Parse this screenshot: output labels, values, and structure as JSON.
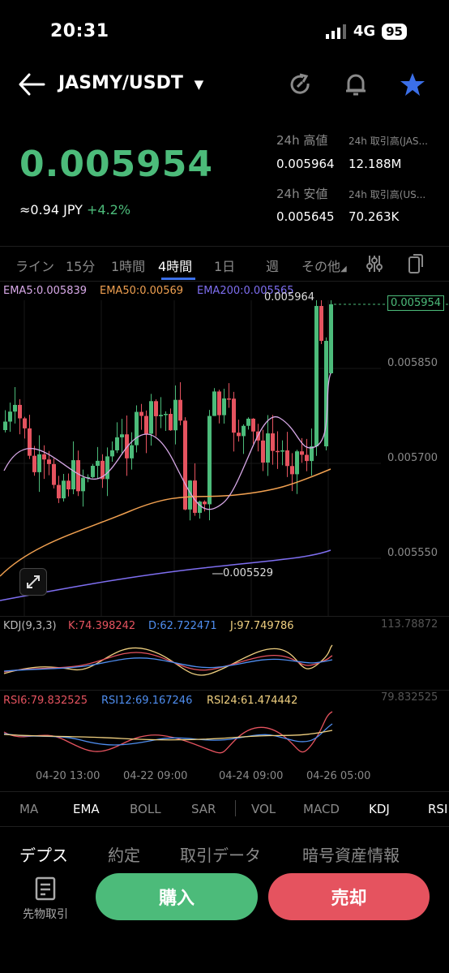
{
  "status": {
    "time": "20:31",
    "network": "4G",
    "battery": "95"
  },
  "header": {
    "pair": "JASMY/USDT"
  },
  "price": {
    "last": "0.005954",
    "jpy": "≈0.94 JPY",
    "change": "+4.2%"
  },
  "stats": {
    "high_label": "24h 高値",
    "high": "0.005964",
    "vol_label": "24h 取引高(JAS...",
    "vol": "12.188M",
    "low_label": "24h 安値",
    "low": "0.005645",
    "turnover_label": "24h 取引高(US...",
    "turnover": "70.263K"
  },
  "timeframes": [
    "ライン",
    "15分",
    "1時間",
    "4時間",
    "1日",
    "週",
    "その他"
  ],
  "active_timeframe": "4時間",
  "ema_legend": {
    "ema5": "EMA5:0.005839",
    "ema50": "EMA50:0.00569",
    "ema200": "EMA200:0.005565"
  },
  "colors": {
    "up": "#4cbb7a",
    "down": "#e5535f",
    "ema5": "#d8a9e8",
    "ema50": "#f0a050",
    "ema200": "#7e6ef0",
    "accent": "#3b6fe8"
  },
  "chart_data": {
    "type": "candlestick",
    "title": "JASMY/USDT 4時間",
    "ylim": [
      0.00549,
      0.00599
    ],
    "y_ticks": [
      "0.005850",
      "0.005700",
      "0.005550"
    ],
    "price_tag": "0.005954",
    "high_marker": "0.005964",
    "low_marker": "0.005529",
    "x_ticks": [
      "04-20 13:00",
      "04-22 09:00",
      "04-24 09:00",
      "04-26 05:00"
    ]
  },
  "kdj": {
    "label": "KDJ(9,3,3)",
    "k": "K:74.398242",
    "d": "D:62.722471",
    "j": "J:97.749786",
    "scale": "113.78872"
  },
  "rsi": {
    "r6": "RSI6:79.832525",
    "r12": "RSI12:69.167246",
    "r24": "RSI24:61.474442",
    "scale": "79.832525"
  },
  "indicators": [
    "MA",
    "EMA",
    "BOLL",
    "SAR",
    "VOL",
    "MACD",
    "KDJ",
    "RSI"
  ],
  "bottom_tabs": [
    "デプス",
    "約定",
    "取引データ",
    "暗号資産情報"
  ],
  "futures_label": "先物取引",
  "buy_label": "購入",
  "sell_label": "売却"
}
